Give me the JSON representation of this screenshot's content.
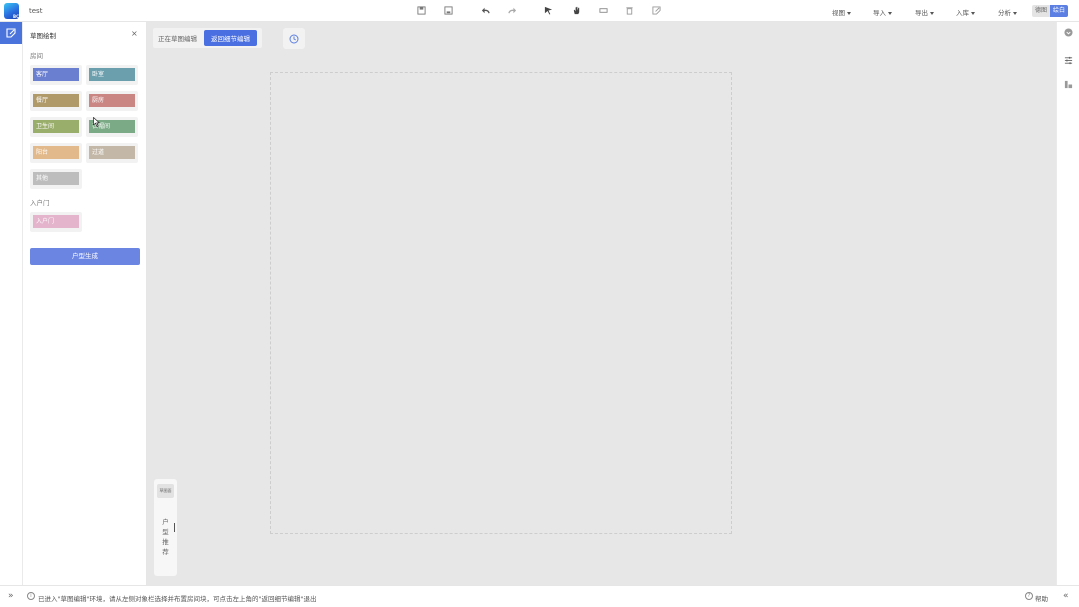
{
  "app": {
    "title": "test"
  },
  "toolbar": {
    "icons": [
      "save-icon",
      "save-as-icon",
      "undo-icon",
      "redo-icon",
      "select-icon",
      "pan-hand-icon",
      "wall-icon",
      "delete-icon",
      "sketch-icon"
    ]
  },
  "menus": [
    {
      "label": "视图"
    },
    {
      "label": "导入"
    },
    {
      "label": "导出"
    },
    {
      "label": "入库"
    },
    {
      "label": "分析"
    }
  ],
  "mode_toggle": {
    "option_a": "德图",
    "option_b": "绘白"
  },
  "panel": {
    "title": "草图绘制",
    "close": "×",
    "rooms_label": "房间",
    "rooms": [
      {
        "label": "客厅",
        "color": "#6b7fd1"
      },
      {
        "label": "卧室",
        "color": "#6b9fae"
      },
      {
        "label": "餐厅",
        "color": "#b09a6a"
      },
      {
        "label": "厨房",
        "color": "#c98683"
      },
      {
        "label": "卫生间",
        "color": "#9aae6c"
      },
      {
        "label": "衣帽间",
        "color": "#7bab86"
      },
      {
        "label": "阳台",
        "color": "#e2b98a"
      },
      {
        "label": "过道",
        "color": "#c3b8a8"
      },
      {
        "label": "其他",
        "color": "#bdbdbd"
      }
    ],
    "door_label": "入户门",
    "door": {
      "label": "入户门",
      "color": "#e3b4cc"
    },
    "generate_button": "户型生成"
  },
  "canvas": {
    "mode_label": "正在草图编辑",
    "return_button": "返回细节编辑",
    "recommend_top": "草图面",
    "recommend_label": "户型推荐"
  },
  "statusbar": {
    "message": "已进入\"草图编辑\"环境，请从左侧对象栏选择并布置房间块，可点击左上角的\"返回细节编辑\"退出",
    "help": "帮助"
  },
  "colors": {
    "accent": "#4a6fe0",
    "canvas": "#e7e7e7"
  }
}
